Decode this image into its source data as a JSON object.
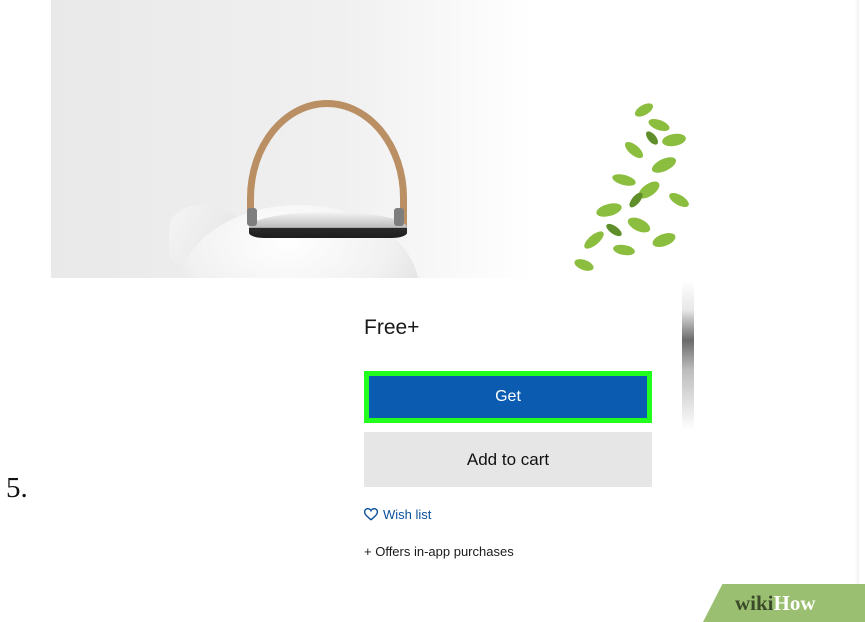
{
  "step": {
    "number": "5."
  },
  "product": {
    "price": "Free+",
    "get_label": "Get",
    "cart_label": "Add to cart",
    "wishlist_label": "Wish list",
    "offers_label": "+ Offers in-app purchases"
  },
  "watermark": {
    "wiki": "wiki",
    "how": "How"
  },
  "colors": {
    "get_button": "#0b5cb0",
    "highlight": "#22ff1e",
    "cart_button": "#e6e6e6",
    "link": "#0b4f9c"
  },
  "icons": {
    "wishlist": "heart-outline-icon"
  }
}
